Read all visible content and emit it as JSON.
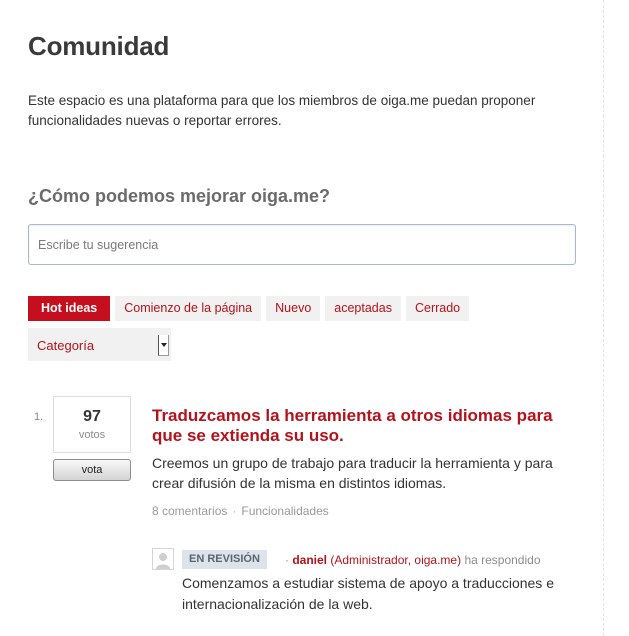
{
  "page": {
    "title": "Comunidad",
    "intro": "Este espacio es una plataforma para que los miembros de oiga.me puedan proponer funcionalidades nuevas o reportar errores."
  },
  "suggestion": {
    "heading": "¿Cómo podemos mejorar oiga.me?",
    "placeholder": "Escribe tu sugerencia",
    "value": ""
  },
  "filters": {
    "tabs": [
      {
        "label": "Hot ideas",
        "active": true
      },
      {
        "label": "Comienzo de la página",
        "active": false
      },
      {
        "label": "Nuevo",
        "active": false
      },
      {
        "label": "aceptadas",
        "active": false
      },
      {
        "label": "Cerrado",
        "active": false
      }
    ],
    "category": {
      "selected": "Categoría"
    }
  },
  "ideas": [
    {
      "rank": "1.",
      "votes": "97",
      "votes_unit": "votos",
      "vote_button": "vota",
      "title": "Traduzcamos la herramienta a otros idiomas para que se extienda su uso.",
      "description": "Creemos un grupo de trabajo para traducir la herramienta y para crear difusión de la misma en distintos idiomas.",
      "comments": "8 comentarios",
      "separator": "·",
      "category": "Funcionalidades",
      "response": {
        "status": "EN REVISIÓN",
        "separator": "·",
        "author": "daniel",
        "role": "(Administrador, oiga.me)",
        "verb": "ha respondido",
        "text": "Comenzamos a estudiar sistema de apoyo a traducciones e internacionalización de la web."
      }
    }
  ],
  "colors": {
    "accent_red": "#c50f1f",
    "link_red": "#b5121b",
    "tab_bg": "#f1f1f1",
    "status_bg": "#dde3ea",
    "muted_text": "#9a9a9a"
  },
  "icons": {
    "avatar": "user-avatar-icon",
    "select_arrow": "chevron-down-icon"
  }
}
